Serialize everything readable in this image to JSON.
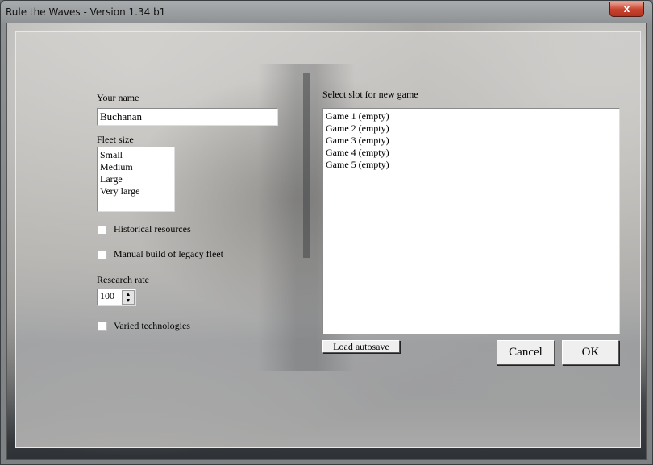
{
  "window": {
    "title": "Rule the Waves - Version 1.34 b1",
    "close_label": "x"
  },
  "form": {
    "name_label": "Your name",
    "name_value": "Buchanan",
    "fleet_label": "Fleet size",
    "fleet_options": [
      "Small",
      "Medium",
      "Large",
      "Very large"
    ],
    "historical_label": "Historical resources",
    "historical_checked": false,
    "manual_label": "Manual build of legacy fleet",
    "manual_checked": false,
    "research_label": "Research rate",
    "research_value": "100",
    "varied_label": "Varied technologies",
    "varied_checked": false
  },
  "slots": {
    "label": "Select slot for new game",
    "items": [
      "Game 1 (empty)",
      "Game 2 (empty)",
      "Game 3 (empty)",
      "Game 4 (empty)",
      "Game 5 (empty)"
    ]
  },
  "buttons": {
    "load_autosave": "Load autosave",
    "cancel": "Cancel",
    "ok": "OK"
  }
}
